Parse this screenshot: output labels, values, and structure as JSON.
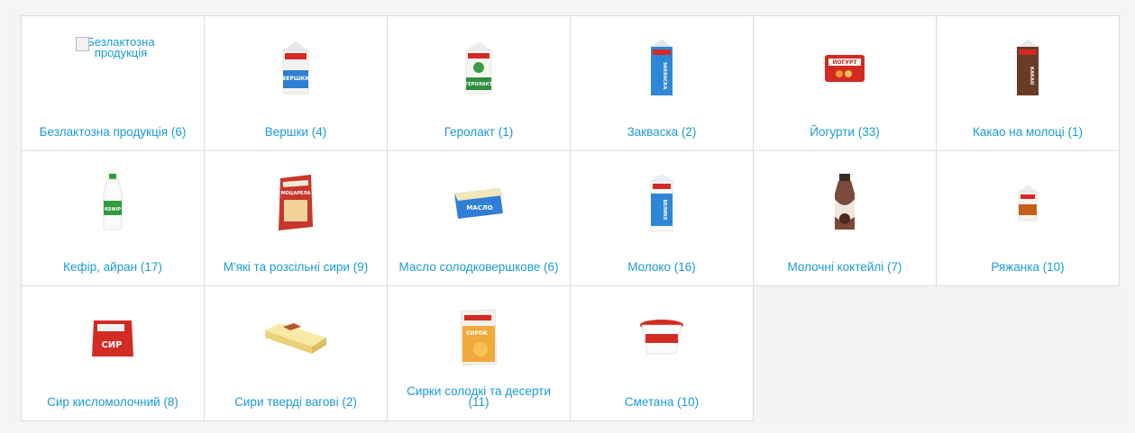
{
  "categories": [
    {
      "label": "Безлактозна продукція (6)",
      "img_alt": "Безлактозна продукція",
      "icon": "broken-image-icon"
    },
    {
      "label": "Вершки (4)",
      "icon": "cream-carton-icon"
    },
    {
      "label": "Геролакт (1)",
      "icon": "gerolakt-carton-icon"
    },
    {
      "label": "Закваска (2)",
      "icon": "zakvaska-carton-icon"
    },
    {
      "label": "Йогурти (33)",
      "icon": "yogurt-pack-icon"
    },
    {
      "label": "Какао на молоці (1)",
      "icon": "cocoa-carton-icon"
    },
    {
      "label": "Кефір, айран (17)",
      "icon": "kefir-bottle-icon"
    },
    {
      "label": "М'які та розсільні сири (9)",
      "icon": "soft-cheese-icon"
    },
    {
      "label": "Масло солодковершкове (6)",
      "icon": "butter-pack-icon"
    },
    {
      "label": "Молоко (16)",
      "icon": "milk-carton-icon"
    },
    {
      "label": "Молочні коктейлі (7)",
      "icon": "milkshake-bottle-icon"
    },
    {
      "label": "Ряжанка (10)",
      "icon": "ryazhanka-carton-icon"
    },
    {
      "label": "Сир кисломолочний (8)",
      "icon": "cottage-cheese-pack-icon"
    },
    {
      "label": "Сири тверді вагові (2)",
      "icon": "hard-cheese-block-icon"
    },
    {
      "label": "Сирки солодкі та десерти (11)",
      "icon": "sweet-curd-pack-icon"
    },
    {
      "label": "Сметана (10)",
      "icon": "sour-cream-cup-icon"
    }
  ],
  "product_print": {
    "cream": "ВЕРШКИ",
    "gerolakt": "ГЕРОЛАКТ",
    "zakvaska": "ЗАКВАСКА",
    "yogurt": "ЙОГУРТ",
    "cocoa": "КАКАО",
    "kefir": "КЕФІР",
    "mozzarella": "МОЦАРЕЛА",
    "butter": "МАСЛО",
    "milk": "ВЕЛИКЕ",
    "cottage": "СИР",
    "curd": "СИРОК"
  },
  "colors": {
    "link": "#1a9ad6",
    "brand_red": "#d42a24",
    "border": "#dcdcdc",
    "background": "#f4f4f4"
  }
}
